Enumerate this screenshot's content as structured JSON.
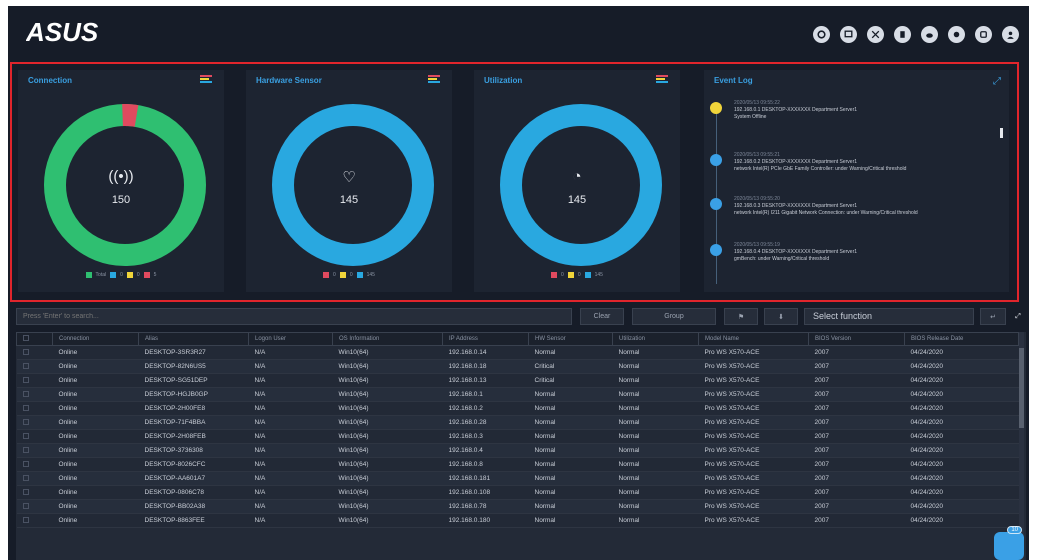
{
  "header": {
    "brand": "ASUS",
    "icons": [
      "settings-icon",
      "monitor-icon",
      "network-icon",
      "power-icon",
      "cloud-icon",
      "message-icon",
      "help-icon",
      "user-icon"
    ]
  },
  "connection": {
    "title": "Connection",
    "value": "150",
    "legend": [
      "Total",
      "0",
      "0",
      "5"
    ],
    "colors": {
      "online": "#2fbf71",
      "offline": "#e04a5f"
    }
  },
  "hardware": {
    "title": "Hardware Sensor",
    "value": "145",
    "legend": [
      "0",
      "0",
      "145"
    ],
    "colors": {
      "normal": "#29a8e0"
    }
  },
  "utilization": {
    "title": "Utilization",
    "value": "145",
    "legend": [
      "0",
      "0",
      "145"
    ],
    "colors": {
      "normal": "#29a8e0"
    }
  },
  "eventlog": {
    "title": "Event Log",
    "events": [
      {
        "time": "2020/05/13 09:55:22",
        "desc1": "192.168.0.1 DESKTOP-XXXXXXX Department Server1",
        "desc2": "System Offline",
        "color": "#f0d43a"
      },
      {
        "time": "2020/05/13 09:55:21",
        "desc1": "192.168.0.2 DESKTOP-XXXXXXX Department Server1",
        "desc2": "network Intel(R) PCIe GbE Family Controller: under Warning/Critical threshold",
        "color": "#3aa0e6"
      },
      {
        "time": "2020/05/13 09:55:20",
        "desc1": "192.168.0.3 DESKTOP-XXXXXXX Department Server1",
        "desc2": "network Intel(R) I211 Gigabit Network Connection: under Warning/Critical threshold",
        "color": "#3aa0e6"
      },
      {
        "time": "2020/05/13 09:55:19",
        "desc1": "192.168.0.4 DESKTOP-XXXXXXX Department Server1",
        "desc2": "gmBench: under Warning/Critical threshold",
        "color": "#3aa0e6"
      }
    ]
  },
  "toolbar": {
    "search_placeholder": "Press 'Enter' to search...",
    "clear": "Clear",
    "group": "Group",
    "select_function": "Select function"
  },
  "table": {
    "headers": [
      "Connection",
      "Alias",
      "Logon User",
      "OS Information",
      "IP Address",
      "HW Sensor",
      "Utilization",
      "Model Name",
      "BIOS Version",
      "BIOS Release Date"
    ],
    "rows": [
      [
        "Online",
        "DESKTOP-3SR3R27",
        "N/A",
        "Win10(64)",
        "192.168.0.14",
        "Normal",
        "Normal",
        "Pro WS X570-ACE",
        "2007",
        "04/24/2020"
      ],
      [
        "Online",
        "DESKTOP-82N6US5",
        "N/A",
        "Win10(64)",
        "192.168.0.18",
        "Critical",
        "Normal",
        "Pro WS X570-ACE",
        "2007",
        "04/24/2020"
      ],
      [
        "Online",
        "DESKTOP-SG51DEP",
        "N/A",
        "Win10(64)",
        "192.168.0.13",
        "Critical",
        "Normal",
        "Pro WS X570-ACE",
        "2007",
        "04/24/2020"
      ],
      [
        "Online",
        "DESKTOP-HGJB0GP",
        "N/A",
        "Win10(64)",
        "192.168.0.1",
        "Normal",
        "Normal",
        "Pro WS X570-ACE",
        "2007",
        "04/24/2020"
      ],
      [
        "Online",
        "DESKTOP-2H00FE8",
        "N/A",
        "Win10(64)",
        "192.168.0.2",
        "Normal",
        "Normal",
        "Pro WS X570-ACE",
        "2007",
        "04/24/2020"
      ],
      [
        "Online",
        "DESKTOP-71F4BBA",
        "N/A",
        "Win10(64)",
        "192.168.0.28",
        "Normal",
        "Normal",
        "Pro WS X570-ACE",
        "2007",
        "04/24/2020"
      ],
      [
        "Online",
        "DESKTOP-2H08FEB",
        "N/A",
        "Win10(64)",
        "192.168.0.3",
        "Normal",
        "Normal",
        "Pro WS X570-ACE",
        "2007",
        "04/24/2020"
      ],
      [
        "Online",
        "DESKTOP-3736308",
        "N/A",
        "Win10(64)",
        "192.168.0.4",
        "Normal",
        "Normal",
        "Pro WS X570-ACE",
        "2007",
        "04/24/2020"
      ],
      [
        "Online",
        "DESKTOP-8026CFC",
        "N/A",
        "Win10(64)",
        "192.168.0.8",
        "Normal",
        "Normal",
        "Pro WS X570-ACE",
        "2007",
        "04/24/2020"
      ],
      [
        "Online",
        "DESKTOP-AA601A7",
        "N/A",
        "Win10(64)",
        "192.168.0.181",
        "Normal",
        "Normal",
        "Pro WS X570-ACE",
        "2007",
        "04/24/2020"
      ],
      [
        "Online",
        "DESKTOP-0806C78",
        "N/A",
        "Win10(64)",
        "192.168.0.108",
        "Normal",
        "Normal",
        "Pro WS X570-ACE",
        "2007",
        "04/24/2020"
      ],
      [
        "Online",
        "DESKTOP-BB02A38",
        "N/A",
        "Win10(64)",
        "192.168.0.78",
        "Normal",
        "Normal",
        "Pro WS X570-ACE",
        "2007",
        "04/24/2020"
      ],
      [
        "Online",
        "DESKTOP-8863FEE",
        "N/A",
        "Win10(64)",
        "192.168.0.180",
        "Normal",
        "Normal",
        "Pro WS X570-ACE",
        "2007",
        "04/24/2020"
      ]
    ]
  },
  "notification": {
    "badge": "10"
  }
}
